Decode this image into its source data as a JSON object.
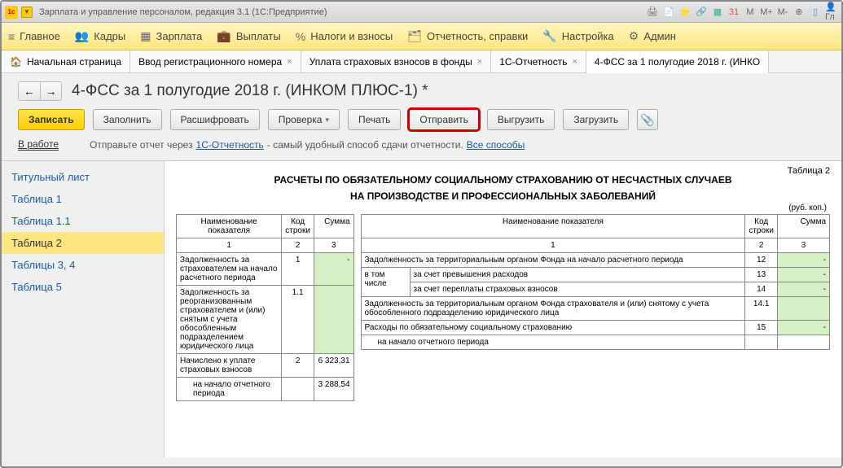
{
  "window": {
    "title": "Зарплата и управление персоналом, редакция 3.1  (1С:Предприятие)",
    "right_icons": [
      "M",
      "M+",
      "M-"
    ]
  },
  "menu": {
    "items": [
      {
        "icon": "≡",
        "label": "Главное"
      },
      {
        "icon": "👥",
        "label": "Кадры"
      },
      {
        "icon": "▦",
        "label": "Зарплата"
      },
      {
        "icon": "💼",
        "label": "Выплаты"
      },
      {
        "icon": "%",
        "label": "Налоги и взносы"
      },
      {
        "icon": "🗂",
        "label": "Отчетность, справки"
      },
      {
        "icon": "🔧",
        "label": "Настройка"
      },
      {
        "icon": "⚙",
        "label": "Админ"
      }
    ]
  },
  "tabs": [
    {
      "label": "Начальная страница",
      "home": true
    },
    {
      "label": "Ввод регистрационного номера"
    },
    {
      "label": "Уплата страховых взносов в фонды"
    },
    {
      "label": "1С-Отчетность"
    },
    {
      "label": "4-ФСС за 1 полугодие 2018 г. (ИНКО",
      "active": true
    }
  ],
  "page": {
    "title": "4-ФСС за 1 полугодие 2018 г. (ИНКОМ ПЛЮС-1) *"
  },
  "toolbar": {
    "save": "Записать",
    "fill": "Заполнить",
    "decode": "Расшифровать",
    "check": "Проверка",
    "print": "Печать",
    "send": "Отправить",
    "export": "Выгрузить",
    "import": "Загрузить"
  },
  "hint": {
    "status": "В работе",
    "text1": "Отправьте отчет через ",
    "link1": "1С-Отчетность",
    "text2": " - самый удобный способ сдачи отчетности. ",
    "link2": "Все способы"
  },
  "sidebar": [
    "Титульный лист",
    "Таблица 1",
    "Таблица 1.1",
    "Таблица 2",
    "Таблицы 3, 4",
    "Таблица 5"
  ],
  "report": {
    "badge": "Таблица 2",
    "title1": "РАСЧЕТЫ ПО ОБЯЗАТЕЛЬНОМУ СОЦИАЛЬНОМУ СТРАХОВАНИЮ ОТ НЕСЧАСТНЫХ СЛУЧАЕВ",
    "title2": "НА ПРОИЗВОДСТВЕ И ПРОФЕССИОНАЛЬНЫХ ЗАБОЛЕВАНИЙ",
    "unit": "(руб. коп.)",
    "headers": {
      "name": "Наименование показателя",
      "code": "Код строки",
      "sum": "Сумма"
    },
    "colnums_left": [
      "1",
      "2",
      "3"
    ],
    "colnums_right": [
      "1",
      "2",
      "3"
    ],
    "left": [
      {
        "name": "Задолженность за страхователем на начало расчетного периода",
        "code": "1",
        "sum": "-"
      },
      {
        "name": "Задолженность за реорганизованным страхователем и (или) снятым с учета обособленным подразделением юридического лица",
        "code": "1.1",
        "sum": ""
      },
      {
        "name": "Начислено к уплате страховых взносов",
        "code": "2",
        "sum": "6 323,31"
      },
      {
        "name": "на начало отчетного периода",
        "code": "",
        "sum": "3 288,54"
      }
    ],
    "right": [
      {
        "name": "Задолженность за территориальным органом Фонда на начало расчетного периода",
        "code": "12",
        "sum": "-"
      },
      {
        "name": "в том числе",
        "sub": "за счет превышения расходов",
        "code": "13",
        "sum": "-"
      },
      {
        "name": "",
        "sub": "за счет переплаты страховых взносов",
        "code": "14",
        "sum": "-"
      },
      {
        "name": "Задолженность за территориальным органом Фонда страхователя и (или) снятому с учета обособленного подразделению юридического лица",
        "code": "14.1",
        "sum": ""
      },
      {
        "name": "Расходы по обязательному социальному страхованию",
        "code": "15",
        "sum": "-"
      },
      {
        "name": "на начало отчетного периода",
        "code": "",
        "sum": ""
      }
    ]
  }
}
